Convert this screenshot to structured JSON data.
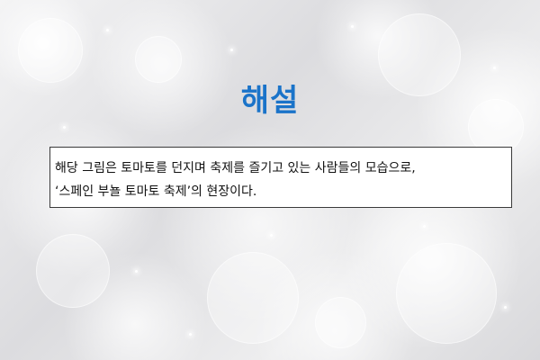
{
  "slide": {
    "title": "해설",
    "title_color": "#1a73c9",
    "description_lines": [
      "해당 그림은 토마토를 던지며 축제를 즐기고 있는 사람들의 모습으로,",
      "‘스페인 부뇰 토마토 축제’의 현장이다."
    ]
  }
}
